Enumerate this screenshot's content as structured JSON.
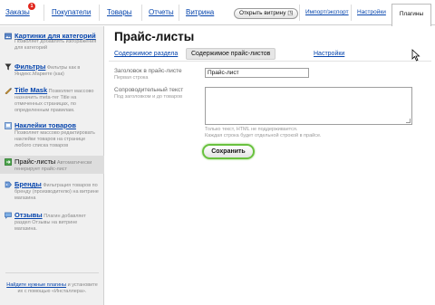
{
  "nav": {
    "orders": "Заказы",
    "orders_badge": "1",
    "customers": "Покупатели",
    "products": "Товары",
    "reports": "Отчеты",
    "storefront": "Витрина",
    "open_storefront": "Открыть витрину",
    "import_export": "Импорт/экспорт",
    "settings": "Настройки",
    "plugins": "Плагины"
  },
  "sidebar": {
    "items": [
      {
        "title": "Картинки для категорий",
        "desc": "Позволяет добавлять изображения для категорий",
        "icon": "image-icon"
      },
      {
        "title": "Фильтры",
        "desc": "Фильтры как в Яндекс.Маркете (как)",
        "icon": "filter-icon"
      },
      {
        "title": "Title Mask",
        "desc": "Позволяет массово назначить meta-тег Title на отмеченных страницах, по определенным правилам.",
        "icon": "title-mask-icon"
      },
      {
        "title": "Наклейки товаров",
        "desc": "Позволяет массово редактировать наклейки товаров на странице любого списка товаров",
        "icon": "sticker-icon"
      },
      {
        "title": "Прайс-листы",
        "desc": "Автоматически генерирует прайс-лист",
        "icon": "price-list-icon"
      },
      {
        "title": "Бренды",
        "desc": "Фильтрация товаров по бренду (производителю) на витрине магазина",
        "icon": "brand-icon"
      },
      {
        "title": "Отзывы",
        "desc": "Плагин добавляет раздел Отзывы на витрине магазина.",
        "icon": "reviews-icon"
      }
    ],
    "footer_link": "Найдите нужные плагины",
    "footer_text": "и установите их с помощью «Инсталлера»."
  },
  "main": {
    "title": "Прайс-листы",
    "tabs": [
      {
        "label": "Содержимое раздела"
      },
      {
        "label": "Содержимое прайс-листов"
      },
      {
        "label": "Настройки"
      }
    ],
    "heading_label": "Заголовок в прайс-листе",
    "heading_sub": "Первая строка",
    "heading_value": "Прайс-лист",
    "text_label": "Сопроводительный текст",
    "text_sub": "Под заголовком и до товаров",
    "text_value": "",
    "hint1": "Только текст, HTML не поддерживается.",
    "hint2": "Каждая строка будет отдельной строкой в прайсе.",
    "save": "Сохранить"
  },
  "colors": {
    "link": "#0645ad",
    "badge": "#e1261c",
    "save_border": "#69c13f",
    "sidebar_bg": "#f0f0f0",
    "sidebar_selected": "#dddddd"
  }
}
